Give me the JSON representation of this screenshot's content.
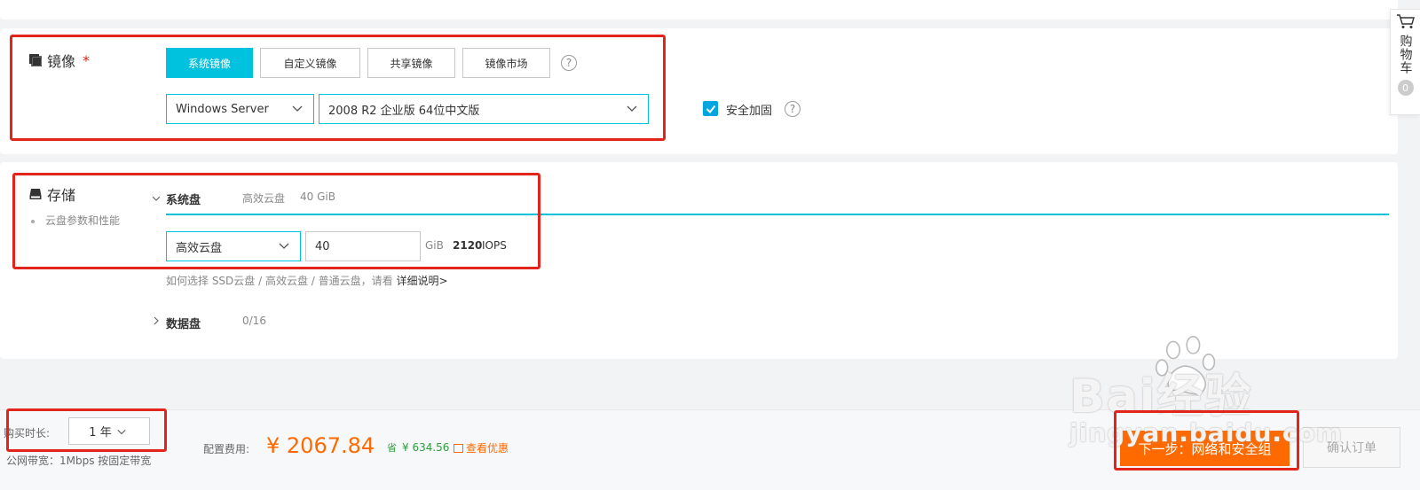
{
  "image_section": {
    "title": "镜像",
    "required_mark": "*",
    "tabs": [
      {
        "label": "系统镜像",
        "active": true
      },
      {
        "label": "自定义镜像",
        "active": false
      },
      {
        "label": "共享镜像",
        "active": false
      },
      {
        "label": "镜像市场",
        "active": false
      }
    ],
    "help": "?",
    "os_type_select": "Windows Server",
    "os_version_select": "2008 R2 企业版 64位中文版",
    "security_hardening_label": "安全加固",
    "security_hardening_checked": true
  },
  "storage_section": {
    "title": "存储",
    "bullet_item": "云盘参数和性能",
    "system_disk": {
      "label": "系统盘",
      "summary_type": "高效云盘",
      "summary_size": "40 GiB",
      "type_select": "高效云盘",
      "size_value": "40",
      "unit": "GiB",
      "iops_value": "2120",
      "iops_unit": "IOPS"
    },
    "hint_text": "如何选择 SSD云盘 / 高效云盘 / 普通云盘，请看",
    "hint_link": "详细说明>",
    "data_disk": {
      "label": "数据盘",
      "count": "0/16"
    }
  },
  "footer": {
    "duration_label": "购买时长:",
    "duration_value": "1 年",
    "bandwidth_text": "公网带宽：1Mbps 按固定带宽",
    "config_fee_label": "配置费用:",
    "price": "¥ 2067.84",
    "save_icon": "省",
    "save_amount": "¥ 634.56",
    "discount_link": "查看优惠",
    "next_button": "下一步：网络和安全组",
    "confirm_button": "确认订单"
  },
  "cart": {
    "label": "购物车",
    "count": "0"
  },
  "watermark": {
    "brand": "Bai经验",
    "url": "jingyan.baidu.com"
  },
  "colors": {
    "accent": "#00c1de",
    "price": "#ff6a00",
    "annotation": "#e1251b",
    "checkbox": "#00a6e0"
  }
}
